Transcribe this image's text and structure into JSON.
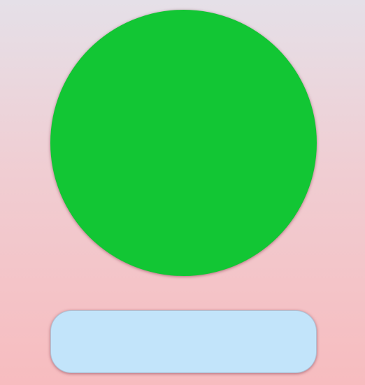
{
  "indicator": {
    "color": "#12c634",
    "shape": "circle"
  },
  "action_button": {
    "label": "",
    "color": "#c2e4fa"
  },
  "background": {
    "top_color": "#e5e0e8",
    "bottom_color": "#f7bcbf"
  }
}
